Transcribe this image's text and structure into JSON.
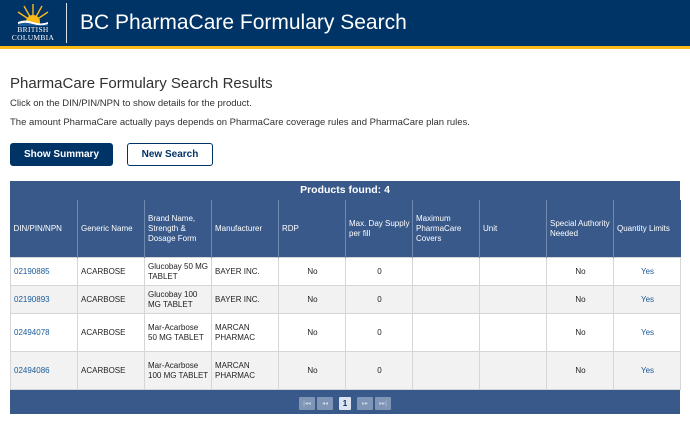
{
  "header": {
    "logo_line1": "BRITISH",
    "logo_line2": "COLUMBIA",
    "title": "BC PharmaCare Formulary Search"
  },
  "page": {
    "results_title": "PharmaCare Formulary Search Results",
    "instruction1": "Click on the DIN/PIN/NPN to show details for the product.",
    "instruction2": "The amount PharmaCare actually pays depends on PharmaCare coverage rules and PharmaCare plan rules."
  },
  "buttons": {
    "show_summary": "Show Summary",
    "new_search": "New Search"
  },
  "table": {
    "products_found": "Products found: 4",
    "headers": [
      "DIN/PIN/NPN",
      "Generic Name",
      "Brand Name, Strength & Dosage Form",
      "Manufacturer",
      "RDP",
      "Max. Day Supply per fill",
      "Maximum PharmaCare Covers",
      "Unit",
      "Special Authority Needed",
      "Quantity Limits"
    ],
    "rows": [
      {
        "din": "02190885",
        "generic": "ACARBOSE",
        "brand": "Glucobay 50 MG TABLET",
        "manufacturer": "BAYER INC.",
        "rdp": "No",
        "max_day": "0",
        "max_covers": "",
        "unit": "",
        "special": "No",
        "quantity": "Yes"
      },
      {
        "din": "02190893",
        "generic": "ACARBOSE",
        "brand": "Glucobay 100 MG TABLET",
        "manufacturer": "BAYER INC.",
        "rdp": "No",
        "max_day": "0",
        "max_covers": "",
        "unit": "",
        "special": "No",
        "quantity": "Yes"
      },
      {
        "din": "02494078",
        "generic": "ACARBOSE",
        "brand": "Mar-Acarbose 50 MG TABLET",
        "manufacturer": "MARCAN PHARMAC",
        "rdp": "No",
        "max_day": "0",
        "max_covers": "",
        "unit": "",
        "special": "No",
        "quantity": "Yes"
      },
      {
        "din": "02494086",
        "generic": "ACARBOSE",
        "brand": "Mar-Acarbose 100 MG TABLET",
        "manufacturer": "MARCAN PHARMAC",
        "rdp": "No",
        "max_day": "0",
        "max_covers": "",
        "unit": "",
        "special": "No",
        "quantity": "Yes"
      }
    ]
  },
  "pager": {
    "first": "|◂◂",
    "prev": "◂◂",
    "current": "1",
    "next": "▸▸",
    "last": "▸▸|"
  },
  "colors": {
    "header_bg": "#003366",
    "accent_gold": "#fcba19",
    "table_header_bg": "#38598a",
    "link": "#1a5a96"
  }
}
